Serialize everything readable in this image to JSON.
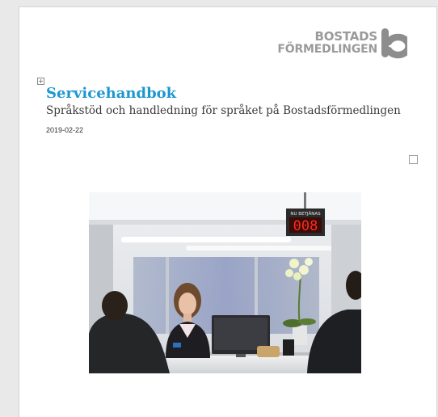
{
  "document": {
    "title": "Servicehandbok",
    "subtitle": "Språkstöd och handledning för språket på Bostadsförmedlingen",
    "date": "2019-02-22"
  },
  "logo": {
    "line1": "BOSTADS",
    "line2": "FÖRMEDLINGEN",
    "color": "#9a9a9a",
    "mark": "bostadsformedlingen-b-icon"
  },
  "photo": {
    "sign_label": "NU BETJÄNAS",
    "sign_number": "008"
  },
  "colors": {
    "title": "#1d97d0",
    "counter": "#ff2a1a"
  }
}
